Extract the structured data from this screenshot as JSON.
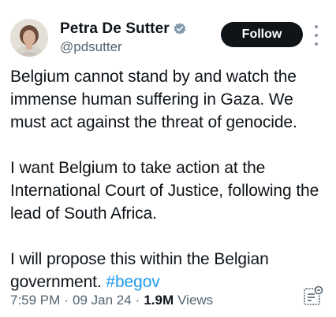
{
  "author": {
    "name": "Petra De Sutter",
    "handle": "@pdsutter",
    "verified_color": "#829aab"
  },
  "actions": {
    "follow_label": "Follow"
  },
  "tweet": {
    "paragraph_1": "Belgium cannot stand by and watch the immense human suffering in Gaza. We must act against the threat of genocide.",
    "paragraph_2": "I want Belgium to take action at the International Court of Justice, following the lead of South Africa.",
    "paragraph_3_text": "I will propose this within the Belgian government.",
    "hashtag": "#begov"
  },
  "meta": {
    "time": "7:59 PM",
    "separator": "·",
    "date": "09 Jan 24",
    "views_count": "1.9M",
    "views_label": "Views"
  },
  "colors": {
    "text": "#0f1419",
    "secondary": "#536471",
    "link": "#1d9bf0",
    "follow_bg": "#0f1419"
  }
}
